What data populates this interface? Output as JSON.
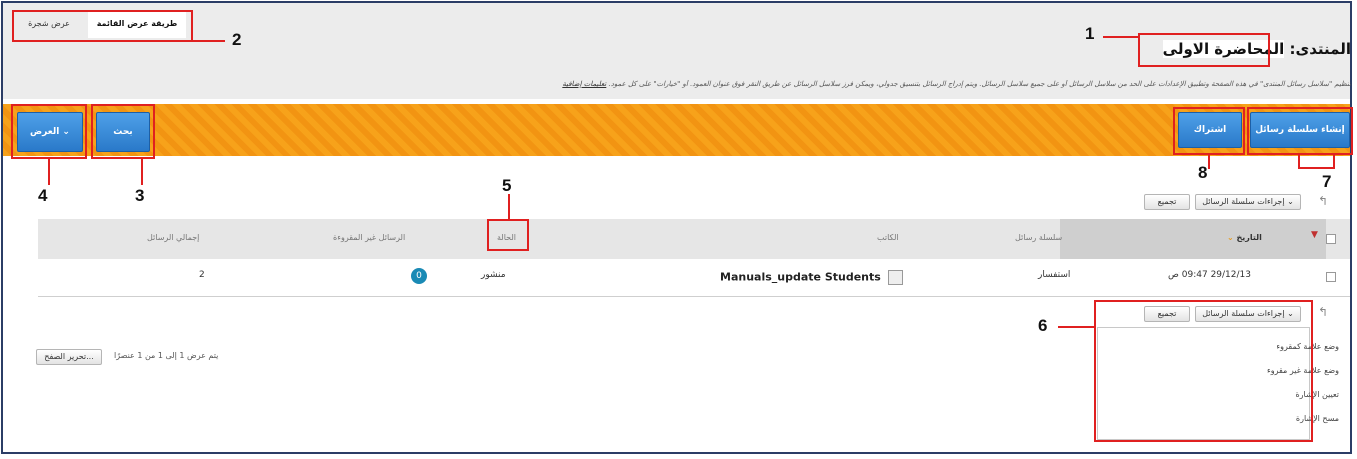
{
  "tabs": {
    "list_view": "طريقة عرض القائمة",
    "grid_view": "عرض شجرة"
  },
  "forum": {
    "prefix": "المنتدى:",
    "name": "المحاضرة الاولى"
  },
  "description": "تنظيم \"سلاسل رسائل المنتدى\" في هذه الصفحة وتطبيق الإعدادات على الحد من سلاسل الرسائل أو على جميع سلاسل الرسائل. ويتم إدراج الرسائل بتنسيق جدولي، ويمكن فرز سلاسل الرسائل عن طريق النقر فوق عنوان العمود. أو \"خيارات\" على كل عمود.",
  "description_link": "تعليمات إضافية",
  "toolbar": {
    "create_thread": "إنشاء سلسلة رسائل",
    "subscribe": "اشتراك",
    "search": "بحث",
    "display": "العرض"
  },
  "thread_actions": {
    "actions_label": "إجراءات سلسلة الرسائل",
    "collect": "تجميع"
  },
  "table": {
    "headers": {
      "date": "التاريخ",
      "thread": "سلسلة رسائل",
      "author": "الكاتب",
      "status": "الحالة",
      "unread": "الرسائل غير المقروءة",
      "total": "إجمالي الرسائل"
    },
    "rows": [
      {
        "date": "29/12/13 09:47 ص",
        "thread": "استفسار",
        "author": "Manuals_update Students",
        "status": "منشور",
        "unread": "0",
        "total": "2"
      }
    ]
  },
  "dropdown": {
    "items": [
      "وضع علامة كمقروء",
      "وضع علامة غير مقروء",
      "تعيين الإشارة",
      "مسح الإشارة"
    ]
  },
  "pagination": {
    "edit_paging": "تحرير الصفح...",
    "status": "يتم عرض 1 إلى 1 من 1 عنصرًا"
  },
  "callouts": {
    "c1": "1",
    "c2": "2",
    "c3": "3",
    "c4": "4",
    "c5": "5",
    "c6": "6",
    "c7": "7",
    "c8": "8"
  },
  "colors": {
    "accent_orange": "#f7a21a",
    "button_blue": "#2a79c9",
    "callout_red": "#e02020",
    "border_navy": "#2b3d66"
  }
}
